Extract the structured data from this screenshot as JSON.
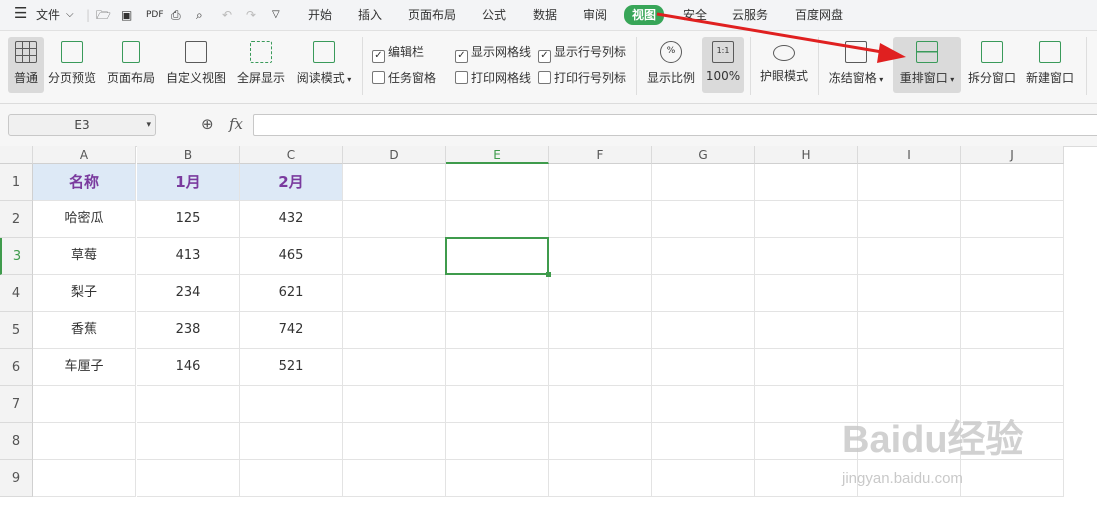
{
  "menu": {
    "file": "文件",
    "tabs": [
      "开始",
      "插入",
      "页面布局",
      "公式",
      "数据",
      "审阅",
      "视图",
      "安全",
      "云服务",
      "百度网盘"
    ],
    "active": "视图"
  },
  "ribbon": {
    "buttons": [
      "普通",
      "分页预览",
      "页面布局",
      "自定义视图",
      "全屏显示",
      "阅读模式"
    ],
    "checks": {
      "edit_bar": "编辑栏",
      "task_pane": "任务窗格",
      "show_grid": "显示网格线",
      "print_grid": "打印网格线",
      "show_rowcol": "显示行号列标",
      "print_rowcol": "打印行号列标"
    },
    "zoom_label": "显示比例",
    "zoom_value": "100%",
    "zoom_icon_text": "1:1",
    "eye_mode": "护眼模式",
    "freeze": "冻结窗格",
    "arrange": "重排窗口",
    "split": "拆分窗口",
    "new_window": "新建窗口"
  },
  "formula_bar": {
    "cell_ref": "E3",
    "fx": "fx",
    "value": ""
  },
  "columns": [
    "A",
    "B",
    "C",
    "D",
    "E",
    "F",
    "G",
    "H",
    "I",
    "J"
  ],
  "rows": [
    "1",
    "2",
    "3",
    "4",
    "5",
    "6",
    "7",
    "8",
    "9"
  ],
  "table": {
    "header": [
      "名称",
      "1月",
      "2月"
    ],
    "data": [
      [
        "哈密瓜",
        "125",
        "432"
      ],
      [
        "草莓",
        "413",
        "465"
      ],
      [
        "梨子",
        "234",
        "621"
      ],
      [
        "香蕉",
        "238",
        "742"
      ],
      [
        "车厘子",
        "146",
        "521"
      ]
    ]
  },
  "watermark": {
    "brand": "Baidu经验",
    "url": "jingyan.baidu.com"
  },
  "colors": {
    "accent": "#37a558",
    "arrow": "#e02020",
    "header_fill": "#dde9f6",
    "header_text": "#7a3a9e"
  }
}
